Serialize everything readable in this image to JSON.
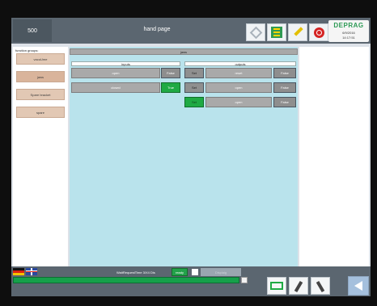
{
  "header": {
    "code": "500",
    "title": "hand page",
    "brand": {
      "name": "DEPRAG",
      "date": "6/9/2016",
      "time": "14:17:51"
    }
  },
  "left": {
    "title": "function groups:",
    "groups": [
      "vacuUme",
      "jaws",
      "Spare bracket",
      "spare"
    ]
  },
  "main": {
    "group_title": "jaws",
    "inputs_title": "inputs",
    "outputs_title": "outputs",
    "inputs": [
      {
        "name": "open",
        "state": "False"
      },
      {
        "name": "closed",
        "state": "True"
      }
    ],
    "outputs": [
      {
        "name": "reset",
        "set": "Set",
        "state": "False"
      },
      {
        "name": "open",
        "set": "Set",
        "state": "False"
      },
      {
        "name": "open",
        "set": "Set",
        "state": "False"
      }
    ]
  },
  "footer": {
    "status_text": "WaitRequestTime 3/X4 Dis",
    "green_label": "ready",
    "disabled_label": "Displaig"
  },
  "colors": {
    "true": "#1faa44",
    "accent_bar": "#5b6670",
    "main_bg": "#b9e3ec"
  },
  "icons": [
    "key-icon",
    "grid-icon",
    "wrench-icon",
    "power-icon",
    "pen-icon",
    "screw-icon",
    "back-icon"
  ]
}
